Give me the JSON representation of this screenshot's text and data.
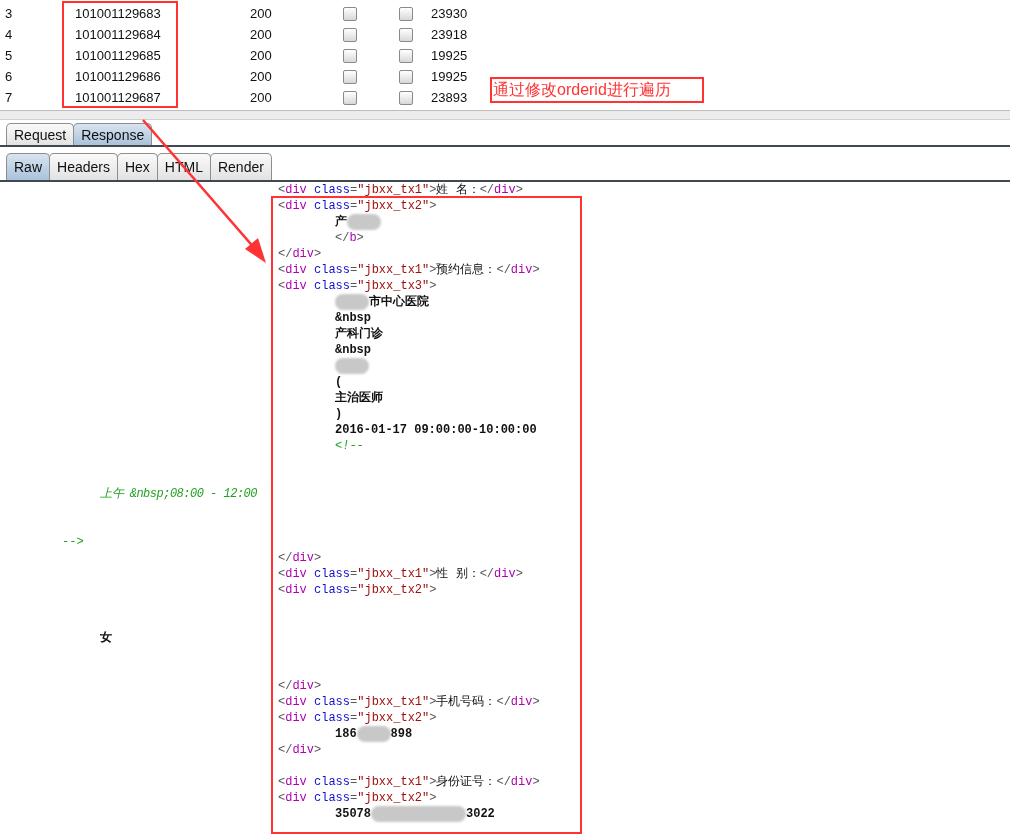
{
  "results_table": {
    "rows": [
      {
        "column_1": "3",
        "column_2": "101001129683",
        "column_3": "200",
        "column_4_checked": false,
        "column_5_checked": false,
        "column_6": "23930"
      },
      {
        "column_1": "4",
        "column_2": "101001129684",
        "column_3": "200",
        "column_4_checked": false,
        "column_5_checked": false,
        "column_6": "23918"
      },
      {
        "column_1": "5",
        "column_2": "101001129685",
        "column_3": "200",
        "column_4_checked": false,
        "column_5_checked": false,
        "column_6": "19925"
      },
      {
        "column_1": "6",
        "column_2": "101001129686",
        "column_3": "200",
        "column_4_checked": false,
        "column_5_checked": false,
        "column_6": "19925"
      },
      {
        "column_1": "7",
        "column_2": "101001129687",
        "column_3": "200",
        "column_4_checked": false,
        "column_5_checked": false,
        "column_6": "23893"
      }
    ]
  },
  "annotation": {
    "text": "通过修改orderid进行遍历"
  },
  "message_tabs": [
    {
      "label": "Request",
      "selected": false
    },
    {
      "label": "Response",
      "selected": true
    }
  ],
  "view_tabs": [
    {
      "label": "Raw",
      "selected": true
    },
    {
      "label": "Headers",
      "selected": false
    },
    {
      "label": "Hex",
      "selected": false
    },
    {
      "label": "HTML",
      "selected": false
    },
    {
      "label": "Render",
      "selected": false
    }
  ],
  "code_lines": [
    {
      "kind": "markup",
      "segments": [
        {
          "kind": "punct",
          "text": "<"
        },
        {
          "kind": "tag",
          "text": "div"
        },
        {
          "kind": "attr",
          "text": " class"
        },
        {
          "kind": "punct",
          "text": "="
        },
        {
          "kind": "string",
          "text": "\"jbxx_tx1\""
        },
        {
          "kind": "punct",
          "text": ">"
        },
        {
          "kind": "text",
          "text": "姓 名："
        },
        {
          "kind": "punct",
          "text": "</"
        },
        {
          "kind": "tag",
          "text": "div"
        },
        {
          "kind": "punct",
          "text": ">"
        }
      ]
    },
    {
      "kind": "markup",
      "segments": [
        {
          "kind": "punct",
          "text": "<"
        },
        {
          "kind": "tag",
          "text": "div"
        },
        {
          "kind": "attr",
          "text": " class"
        },
        {
          "kind": "punct",
          "text": "="
        },
        {
          "kind": "string",
          "text": "\"jbxx_tx2\""
        },
        {
          "kind": "punct",
          "text": ">"
        }
      ]
    },
    {
      "kind": "content",
      "segments": [
        {
          "kind": "bold",
          "text": "产"
        },
        {
          "kind": "blur"
        }
      ]
    },
    {
      "kind": "content",
      "segments": [
        {
          "kind": "punct",
          "text": "</"
        },
        {
          "kind": "tag",
          "text": "b"
        },
        {
          "kind": "punct",
          "text": ">"
        }
      ]
    },
    {
      "kind": "markup",
      "segments": [
        {
          "kind": "punct",
          "text": "</"
        },
        {
          "kind": "tag",
          "text": "div"
        },
        {
          "kind": "punct",
          "text": ">"
        }
      ]
    },
    {
      "kind": "markup",
      "segments": [
        {
          "kind": "punct",
          "text": "<"
        },
        {
          "kind": "tag",
          "text": "div"
        },
        {
          "kind": "attr",
          "text": " class"
        },
        {
          "kind": "punct",
          "text": "="
        },
        {
          "kind": "string",
          "text": "\"jbxx_tx1\""
        },
        {
          "kind": "punct",
          "text": ">"
        },
        {
          "kind": "text",
          "text": "预约信息："
        },
        {
          "kind": "punct",
          "text": "</"
        },
        {
          "kind": "tag",
          "text": "div"
        },
        {
          "kind": "punct",
          "text": ">"
        }
      ]
    },
    {
      "kind": "markup",
      "segments": [
        {
          "kind": "punct",
          "text": "<"
        },
        {
          "kind": "tag",
          "text": "div"
        },
        {
          "kind": "attr",
          "text": " class"
        },
        {
          "kind": "punct",
          "text": "="
        },
        {
          "kind": "string",
          "text": "\"jbxx_tx3\""
        },
        {
          "kind": "punct",
          "text": ">"
        }
      ]
    },
    {
      "kind": "content",
      "segments": [
        {
          "kind": "blur"
        },
        {
          "kind": "bold",
          "text": "市中心医院"
        }
      ]
    },
    {
      "kind": "content",
      "segments": [
        {
          "kind": "bold",
          "text": "&nbsp"
        }
      ]
    },
    {
      "kind": "content",
      "segments": [
        {
          "kind": "bold",
          "text": "产科门诊"
        }
      ]
    },
    {
      "kind": "content",
      "segments": [
        {
          "kind": "bold",
          "text": "&nbsp"
        }
      ]
    },
    {
      "kind": "content",
      "segments": [
        {
          "kind": "blur"
        }
      ]
    },
    {
      "kind": "content",
      "segments": [
        {
          "kind": "bold",
          "text": "("
        }
      ]
    },
    {
      "kind": "content",
      "segments": [
        {
          "kind": "bold",
          "text": "主治医师"
        }
      ]
    },
    {
      "kind": "content",
      "segments": [
        {
          "kind": "bold",
          "text": ")"
        }
      ]
    },
    {
      "kind": "content",
      "segments": [
        {
          "kind": "bold",
          "text": "2016-01-17 09:00:00-10:00:00"
        }
      ]
    },
    {
      "kind": "content",
      "segments": [
        {
          "kind": "comment",
          "text": "<!--"
        }
      ]
    },
    {
      "kind": "blank"
    },
    {
      "kind": "blank"
    },
    {
      "kind": "inner",
      "segments": [
        {
          "kind": "comment",
          "text": "上午 &nbsp;08:00 - 12:00"
        }
      ]
    },
    {
      "kind": "blank"
    },
    {
      "kind": "blank"
    },
    {
      "kind": "outer",
      "segments": [
        {
          "kind": "comment",
          "text": "-->"
        }
      ]
    },
    {
      "kind": "markup",
      "segments": [
        {
          "kind": "punct",
          "text": "</"
        },
        {
          "kind": "tag",
          "text": "div"
        },
        {
          "kind": "punct",
          "text": ">"
        }
      ]
    },
    {
      "kind": "markup",
      "segments": [
        {
          "kind": "punct",
          "text": "<"
        },
        {
          "kind": "tag",
          "text": "div"
        },
        {
          "kind": "attr",
          "text": " class"
        },
        {
          "kind": "punct",
          "text": "="
        },
        {
          "kind": "string",
          "text": "\"jbxx_tx1\""
        },
        {
          "kind": "punct",
          "text": ">"
        },
        {
          "kind": "text",
          "text": "性 别："
        },
        {
          "kind": "punct",
          "text": "</"
        },
        {
          "kind": "tag",
          "text": "div"
        },
        {
          "kind": "punct",
          "text": ">"
        }
      ]
    },
    {
      "kind": "markup",
      "segments": [
        {
          "kind": "punct",
          "text": "<"
        },
        {
          "kind": "tag",
          "text": "div"
        },
        {
          "kind": "attr",
          "text": " class"
        },
        {
          "kind": "punct",
          "text": "="
        },
        {
          "kind": "string",
          "text": "\"jbxx_tx2\""
        },
        {
          "kind": "punct",
          "text": ">"
        }
      ]
    },
    {
      "kind": "blank"
    },
    {
      "kind": "blank"
    },
    {
      "kind": "inner",
      "segments": [
        {
          "kind": "bold",
          "text": "女"
        }
      ]
    },
    {
      "kind": "blank"
    },
    {
      "kind": "blank"
    },
    {
      "kind": "markup",
      "segments": [
        {
          "kind": "punct",
          "text": "</"
        },
        {
          "kind": "tag",
          "text": "div"
        },
        {
          "kind": "punct",
          "text": ">"
        }
      ]
    },
    {
      "kind": "markup",
      "segments": [
        {
          "kind": "punct",
          "text": "<"
        },
        {
          "kind": "tag",
          "text": "div"
        },
        {
          "kind": "attr",
          "text": " class"
        },
        {
          "kind": "punct",
          "text": "="
        },
        {
          "kind": "string",
          "text": "\"jbxx_tx1\""
        },
        {
          "kind": "punct",
          "text": ">"
        },
        {
          "kind": "text",
          "text": "手机号码："
        },
        {
          "kind": "punct",
          "text": "</"
        },
        {
          "kind": "tag",
          "text": "div"
        },
        {
          "kind": "punct",
          "text": ">"
        }
      ]
    },
    {
      "kind": "markup",
      "segments": [
        {
          "kind": "punct",
          "text": "<"
        },
        {
          "kind": "tag",
          "text": "div"
        },
        {
          "kind": "attr",
          "text": " class"
        },
        {
          "kind": "punct",
          "text": "="
        },
        {
          "kind": "string",
          "text": "\"jbxx_tx2\""
        },
        {
          "kind": "punct",
          "text": ">"
        }
      ]
    },
    {
      "kind": "content",
      "segments": [
        {
          "kind": "bold",
          "text": "186"
        },
        {
          "kind": "blur"
        },
        {
          "kind": "bold",
          "text": "898"
        }
      ]
    },
    {
      "kind": "markup",
      "segments": [
        {
          "kind": "punct",
          "text": "</"
        },
        {
          "kind": "tag",
          "text": "div"
        },
        {
          "kind": "punct",
          "text": ">"
        }
      ]
    },
    {
      "kind": "blank"
    },
    {
      "kind": "markup",
      "segments": [
        {
          "kind": "punct",
          "text": "<"
        },
        {
          "kind": "tag",
          "text": "div"
        },
        {
          "kind": "attr",
          "text": " class"
        },
        {
          "kind": "punct",
          "text": "="
        },
        {
          "kind": "string",
          "text": "\"jbxx_tx1\""
        },
        {
          "kind": "punct",
          "text": ">"
        },
        {
          "kind": "text",
          "text": "身份证号："
        },
        {
          "kind": "punct",
          "text": "</"
        },
        {
          "kind": "tag",
          "text": "div"
        },
        {
          "kind": "punct",
          "text": ">"
        }
      ]
    },
    {
      "kind": "markup",
      "segments": [
        {
          "kind": "punct",
          "text": "<"
        },
        {
          "kind": "tag",
          "text": "div"
        },
        {
          "kind": "attr",
          "text": " class"
        },
        {
          "kind": "punct",
          "text": "="
        },
        {
          "kind": "string",
          "text": "\"jbxx_tx2\""
        },
        {
          "kind": "punct",
          "text": ">"
        }
      ]
    },
    {
      "kind": "content",
      "segments": [
        {
          "kind": "bold",
          "text": "35078"
        },
        {
          "kind": "wideblur"
        },
        {
          "kind": "bold",
          "text": "3022"
        }
      ]
    }
  ]
}
